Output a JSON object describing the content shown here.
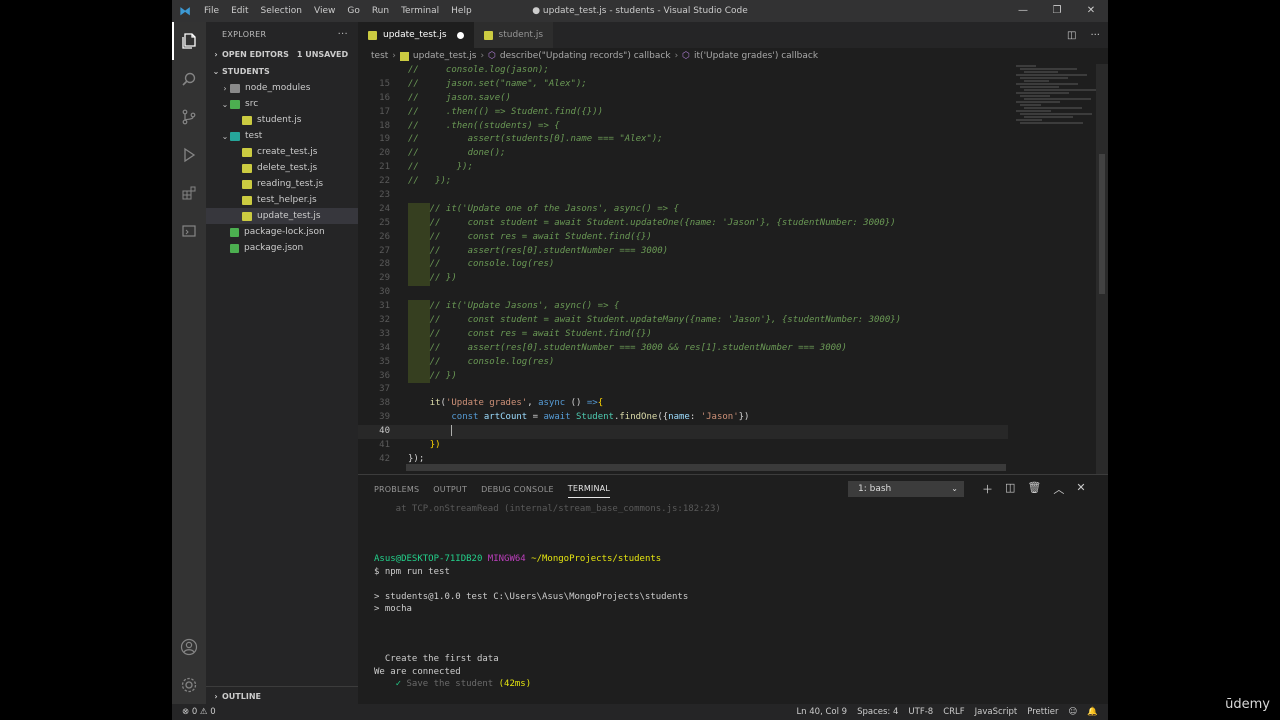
{
  "window": {
    "title": "● update_test.js - students - Visual Studio Code",
    "menu": [
      "File",
      "Edit",
      "Selection",
      "View",
      "Go",
      "Run",
      "Terminal",
      "Help"
    ]
  },
  "sidebar": {
    "header": "EXPLORER",
    "open_editors": "OPEN EDITORS",
    "unsaved_badge": "1 UNSAVED",
    "project": "STUDENTS",
    "tree": [
      {
        "label": "node_modules",
        "type": "folder",
        "depth": 1,
        "chev": "›"
      },
      {
        "label": "src",
        "type": "src",
        "depth": 1,
        "chev": "⌄"
      },
      {
        "label": "student.js",
        "type": "js",
        "depth": 2,
        "chev": ""
      },
      {
        "label": "test",
        "type": "test",
        "depth": 1,
        "chev": "⌄"
      },
      {
        "label": "create_test.js",
        "type": "js",
        "depth": 2,
        "chev": ""
      },
      {
        "label": "delete_test.js",
        "type": "js",
        "depth": 2,
        "chev": ""
      },
      {
        "label": "reading_test.js",
        "type": "js",
        "depth": 2,
        "chev": ""
      },
      {
        "label": "test_helper.js",
        "type": "js",
        "depth": 2,
        "chev": ""
      },
      {
        "label": "update_test.js",
        "type": "js",
        "depth": 2,
        "chev": "",
        "selected": true
      },
      {
        "label": "package-lock.json",
        "type": "json",
        "depth": 1,
        "chev": ""
      },
      {
        "label": "package.json",
        "type": "json",
        "depth": 1,
        "chev": ""
      }
    ],
    "outline": "OUTLINE"
  },
  "tabs": [
    {
      "label": "update_test.js",
      "active": true,
      "dirty": true
    },
    {
      "label": "student.js",
      "active": false,
      "dirty": false
    }
  ],
  "breadcrumb": {
    "folder": "test",
    "file": "update_test.js",
    "scope1": "describe(\"Updating records\") callback",
    "scope2": "it('Update grades') callback"
  },
  "code_lines": [
    {
      "n": "",
      "tokens": [
        [
          "c-comment",
          "//     console.log(jason);"
        ]
      ]
    },
    {
      "n": "15",
      "tokens": [
        [
          "c-comment",
          "//     jason.set(\"name\", \"Alex\");"
        ]
      ]
    },
    {
      "n": "16",
      "tokens": [
        [
          "c-comment",
          "//     jason.save()"
        ]
      ]
    },
    {
      "n": "17",
      "tokens": [
        [
          "c-comment",
          "//     .then(() => Student.find({}))"
        ]
      ]
    },
    {
      "n": "18",
      "tokens": [
        [
          "c-comment",
          "//     .then((students) => {"
        ]
      ]
    },
    {
      "n": "19",
      "tokens": [
        [
          "c-comment",
          "//         assert(students[0].name === \"Alex\");"
        ]
      ]
    },
    {
      "n": "20",
      "tokens": [
        [
          "c-comment",
          "//         done();"
        ]
      ]
    },
    {
      "n": "21",
      "tokens": [
        [
          "c-comment",
          "//       });"
        ]
      ]
    },
    {
      "n": "22",
      "tokens": [
        [
          "c-comment",
          "//   });"
        ]
      ]
    },
    {
      "n": "23",
      "tokens": [
        [
          "c-plain",
          ""
        ]
      ]
    },
    {
      "n": "24",
      "ind": true,
      "tokens": [
        [
          "c-comment",
          "    // it('Update one of the Jasons', async() => {"
        ]
      ]
    },
    {
      "n": "25",
      "ind": true,
      "tokens": [
        [
          "c-comment",
          "    //     const student = await Student.updateOne({name: 'Jason'}, {studentNumber: 3000})"
        ]
      ]
    },
    {
      "n": "26",
      "ind": true,
      "tokens": [
        [
          "c-comment",
          "    //     const res = await Student.find({})"
        ]
      ]
    },
    {
      "n": "27",
      "ind": true,
      "tokens": [
        [
          "c-comment",
          "    //     assert(res[0].studentNumber === 3000)"
        ]
      ]
    },
    {
      "n": "28",
      "ind": true,
      "tokens": [
        [
          "c-comment",
          "    //     console.log(res)"
        ]
      ]
    },
    {
      "n": "29",
      "ind": true,
      "tokens": [
        [
          "c-comment",
          "    // })"
        ]
      ]
    },
    {
      "n": "30",
      "tokens": [
        [
          "c-plain",
          ""
        ]
      ]
    },
    {
      "n": "31",
      "ind": true,
      "tokens": [
        [
          "c-comment",
          "    // it('Update Jasons', async() => {"
        ]
      ]
    },
    {
      "n": "32",
      "ind": true,
      "tokens": [
        [
          "c-comment",
          "    //     const student = await Student.updateMany({name: 'Jason'}, {studentNumber: 3000})"
        ]
      ]
    },
    {
      "n": "33",
      "ind": true,
      "tokens": [
        [
          "c-comment",
          "    //     const res = await Student.find({})"
        ]
      ]
    },
    {
      "n": "34",
      "ind": true,
      "tokens": [
        [
          "c-comment",
          "    //     assert(res[0].studentNumber === 3000 && res[1].studentNumber === 3000)"
        ]
      ]
    },
    {
      "n": "35",
      "ind": true,
      "tokens": [
        [
          "c-comment",
          "    //     console.log(res)"
        ]
      ]
    },
    {
      "n": "36",
      "ind": true,
      "tokens": [
        [
          "c-comment",
          "    // })"
        ]
      ]
    },
    {
      "n": "37",
      "tokens": [
        [
          "c-plain",
          ""
        ]
      ]
    },
    {
      "n": "38",
      "tokens": [
        [
          "c-plain",
          "    "
        ],
        [
          "c-fn",
          "it"
        ],
        [
          "c-plain",
          "("
        ],
        [
          "c-str",
          "'Update grades'"
        ],
        [
          "c-plain",
          ", "
        ],
        [
          "c-kw",
          "async"
        ],
        [
          "c-plain",
          " () "
        ],
        [
          "c-kw",
          "=>"
        ],
        [
          "c-brk",
          "{"
        ]
      ]
    },
    {
      "n": "39",
      "tokens": [
        [
          "c-plain",
          "        "
        ],
        [
          "c-kw",
          "const"
        ],
        [
          "c-plain",
          " "
        ],
        [
          "c-var",
          "artCount"
        ],
        [
          "c-plain",
          " = "
        ],
        [
          "c-kw",
          "await"
        ],
        [
          "c-plain",
          " "
        ],
        [
          "c-cls",
          "Student"
        ],
        [
          "c-plain",
          "."
        ],
        [
          "c-fn",
          "findOne"
        ],
        [
          "c-plain",
          "({"
        ],
        [
          "c-var",
          "name"
        ],
        [
          "c-plain",
          ": "
        ],
        [
          "c-str",
          "'Jason'"
        ],
        [
          "c-plain",
          "})"
        ]
      ]
    },
    {
      "n": "40",
      "current": true,
      "cursor": true,
      "tokens": [
        [
          "c-plain",
          "        "
        ]
      ]
    },
    {
      "n": "41",
      "tokens": [
        [
          "c-plain",
          "    "
        ],
        [
          "c-brk",
          "})"
        ]
      ]
    },
    {
      "n": "42",
      "tokens": [
        [
          "c-plain",
          "});"
        ]
      ]
    }
  ],
  "panel": {
    "tabs": [
      "PROBLEMS",
      "OUTPUT",
      "DEBUG CONSOLE",
      "TERMINAL"
    ],
    "active_tab": "TERMINAL",
    "terminal_select": "1: bash"
  },
  "terminal_lines": [
    [
      [
        "t-dim",
        "    at TCP.onStreamRead (internal/stream_base_commons.js:182:23)"
      ]
    ],
    [
      [
        "",
        ""
      ]
    ],
    [
      [
        "",
        ""
      ]
    ],
    [
      [
        "",
        ""
      ]
    ],
    [
      [
        "t-green",
        "Asus@DESKTOP-71IDB20"
      ],
      [
        "",
        " "
      ],
      [
        "t-purple",
        "MINGW64"
      ],
      [
        "",
        " "
      ],
      [
        "t-yellow",
        "~/MongoProjects/students"
      ]
    ],
    [
      [
        "",
        "$ npm run test"
      ]
    ],
    [
      [
        "",
        ""
      ]
    ],
    [
      [
        "",
        "> students@1.0.0 test C:\\Users\\Asus\\MongoProjects\\students"
      ]
    ],
    [
      [
        "",
        "> mocha"
      ]
    ],
    [
      [
        "",
        ""
      ]
    ],
    [
      [
        "",
        ""
      ]
    ],
    [
      [
        "",
        ""
      ]
    ],
    [
      [
        "",
        "  Create the first data"
      ]
    ],
    [
      [
        "",
        "We are connected"
      ]
    ],
    [
      [
        "t-green",
        "    ✓ "
      ],
      [
        "t-grey",
        "Save the student"
      ],
      [
        "t-yellow",
        " (42ms)"
      ]
    ]
  ],
  "status": {
    "problems": "⊗ 0 ⚠ 0",
    "position": "Ln 40, Col 9",
    "spaces": "Spaces: 4",
    "encoding": "UTF-8",
    "eol": "CRLF",
    "language": "JavaScript",
    "formatter": "Prettier"
  },
  "watermark": "ūdemy"
}
